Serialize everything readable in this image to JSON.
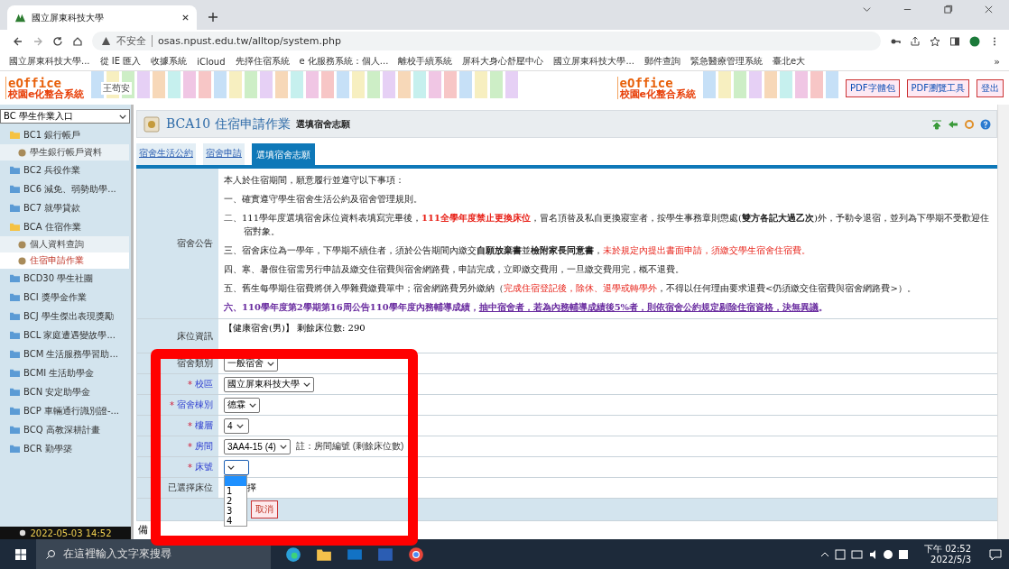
{
  "browser": {
    "tab_title": "國立屏東科技大學",
    "security": "不安全",
    "url": "osas.npust.edu.tw/alltop/system.php",
    "bookmarks": [
      "國立屏東科技大學...",
      "從 IE 匯入",
      "收據系統",
      "iCloud",
      "先擇住宿系統",
      "e 化服務系統：個人...",
      "離校手續系統",
      "屏科大身心舒壓中心",
      "國立屏東科技大學...",
      "郵件查詢",
      "緊急醫療管理系統",
      "臺北e大"
    ],
    "bookmarks_more": "»"
  },
  "header": {
    "logo_left": {
      "en": "eOffice",
      "zh": "校園e化整合系統"
    },
    "user": "王苟安",
    "logo_right": {
      "en": "eOffice",
      "zh": "校園e化整合系統"
    },
    "buttons": [
      "PDF字體包",
      "PDF瀏覽工具",
      "登出"
    ]
  },
  "sidebar": {
    "module": "BC 學生作業入口",
    "clock": "2022-05-03 14:52",
    "items": [
      {
        "label": "BC1 銀行帳戶",
        "expanded": true,
        "children": [
          {
            "label": "學生銀行帳戶資料",
            "selected": false
          }
        ]
      },
      {
        "label": "BC2 兵役作業",
        "expanded": false
      },
      {
        "label": "BC6 減免、弱勢助學...",
        "expanded": false
      },
      {
        "label": "BC7 就學貸款",
        "expanded": false
      },
      {
        "label": "BCA 住宿作業",
        "expanded": true,
        "children": [
          {
            "label": "個人資料查詢",
            "selected": false
          },
          {
            "label": "住宿申請作業",
            "selected": true
          }
        ]
      },
      {
        "label": "BCD30 學生社團",
        "expanded": false
      },
      {
        "label": "BCI 獎學金作業",
        "expanded": false
      },
      {
        "label": "BCJ 學生傑出表現獎勵",
        "expanded": false
      },
      {
        "label": "BCL 家庭遭遇變故學...",
        "expanded": false
      },
      {
        "label": "BCM 生活服務學習助...",
        "expanded": false
      },
      {
        "label": "BCMI 生活助學金",
        "expanded": false
      },
      {
        "label": "BCN 安定助學金",
        "expanded": false
      },
      {
        "label": "BCP 車輛通行識別證-...",
        "expanded": false
      },
      {
        "label": "BCQ 高教深耕計畫",
        "expanded": false
      },
      {
        "label": "BCR 勤學築",
        "expanded": false
      }
    ]
  },
  "page": {
    "title": "BCA10 住宿申請作業",
    "subtitle": "選填宿舍志願",
    "tabs": [
      {
        "label": "宿舍生活公約",
        "selected": false
      },
      {
        "label": "宿舍申請",
        "selected": false
      },
      {
        "label": "選填宿舍志願",
        "selected": true
      }
    ],
    "notice_label": "宿舍公告",
    "notices": [
      [
        {
          "text": "本人於住宿期間，願意履行並遵守以下事項：",
          "kind": "plain"
        }
      ],
      [
        {
          "text": "一、確實遵守學生宿舍生活公約及宿舍管理規則。",
          "kind": "plain"
        }
      ],
      [
        {
          "text": "二、111學年度選填宿舍床位資料表填寫完畢後，",
          "kind": "plain"
        },
        {
          "text": "111全學年度禁止更換床位",
          "kind": "warning"
        },
        {
          "text": "，冒名頂替及私自更換寢室者，按學生事務章則懲處(",
          "kind": "plain"
        },
        {
          "text": "雙方各記大過乙次",
          "kind": "emphasis"
        },
        {
          "text": ")外，予勒令退宿，並列為下學期不受歡迎住宿對象。",
          "kind": "plain"
        }
      ],
      [
        {
          "text": "三、宿舍床位為一學年，下學期不續住者，須於公告期間內繳交",
          "kind": "plain"
        },
        {
          "text": "自願放棄書",
          "kind": "emphasis"
        },
        {
          "text": "並",
          "kind": "plain"
        },
        {
          "text": "檢附家長同意書",
          "kind": "emphasis"
        },
        {
          "text": "，",
          "kind": "plain"
        },
        {
          "text": "未於規定內提出書面申請，須繳交學生宿舍住宿費。",
          "kind": "caution"
        }
      ],
      [
        {
          "text": "四、寒、暑假住宿需另行申請及繳交住宿費與宿舍網路費，申請完成，立即繳交費用，一旦繳交費用完，概不退費。",
          "kind": "plain"
        }
      ],
      [
        {
          "text": "五、舊生每學期住宿費將併入學雜費繳費單中；宿舍網路費另外繳納（",
          "kind": "plain"
        },
        {
          "text": "完成住宿登記後，除休、退學或轉學外",
          "kind": "caution"
        },
        {
          "text": "，不得以任何理由要求退費<仍須繳交住宿費與宿舍網路費>）。",
          "kind": "plain"
        }
      ],
      [
        {
          "text": "六、110學年度第2學期第16周公告110學年度內務輔導成績，",
          "kind": "announcement"
        },
        {
          "text": "抽中宿舍者，若為內務輔導成績後5%者，則依宿舍公約規定剔除住宿資格，決無異議",
          "kind": "announcement-link"
        },
        {
          "text": "。",
          "kind": "announcement"
        }
      ]
    ],
    "bed_info_label": "床位資訊",
    "bed_info": "【健康宿舍(男)】 剩餘床位數: 290",
    "required_mark": "*",
    "fields": [
      {
        "label": "宿舍類別",
        "required": false,
        "value": "一般宿舍",
        "open": false
      },
      {
        "label": "校區",
        "required": true,
        "value": "國立屏東科技大學",
        "open": false
      },
      {
        "label": "宿舍棟別",
        "required": true,
        "value": "德霖",
        "open": false
      },
      {
        "label": "樓層",
        "required": true,
        "value": "4",
        "open": false
      },
      {
        "label": "房間",
        "required": true,
        "value": "3AA4-15 (4)",
        "note": "註：房間編號 (剩餘床位數)",
        "open": false
      },
      {
        "label": "床號",
        "required": true,
        "open": true
      }
    ],
    "dropdown_options": [
      {
        "selected": true
      },
      {
        "label": "1",
        "selected": false
      },
      {
        "label": "2",
        "selected": false
      },
      {
        "label": "3",
        "selected": false
      },
      {
        "label": "4",
        "selected": false
      }
    ],
    "chosen_label": "已選擇床位",
    "chosen_value": "擇",
    "buttons": [
      "取消"
    ],
    "remark": "備"
  },
  "taskbar": {
    "search_placeholder": "在這裡輸入文字來搜尋",
    "time": "下午 02:52",
    "date": "2022/5/3"
  }
}
